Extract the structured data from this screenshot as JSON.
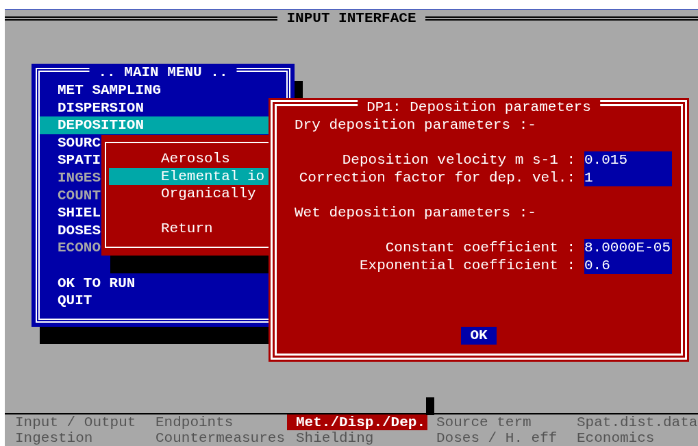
{
  "screen_title": "INPUT INTERFACE",
  "main_menu": {
    "title": ".. MAIN MENU ..",
    "items": [
      {
        "label": "MET SAMPLING",
        "selected": false,
        "disabled": false
      },
      {
        "label": "DISPERSION",
        "selected": false,
        "disabled": false
      },
      {
        "label": "DEPOSITION",
        "selected": true,
        "disabled": false
      },
      {
        "label": "SOURC",
        "selected": false,
        "disabled": false
      },
      {
        "label": "SPATI",
        "selected": false,
        "disabled": false
      },
      {
        "label": "INGES",
        "selected": false,
        "disabled": true
      },
      {
        "label": "COUNT",
        "selected": false,
        "disabled": true
      },
      {
        "label": "SHIEL",
        "selected": false,
        "disabled": false
      },
      {
        "label": "DOSES",
        "selected": false,
        "disabled": false
      },
      {
        "label": "ECONO",
        "selected": false,
        "disabled": true
      }
    ],
    "actions": [
      {
        "label": "OK TO RUN",
        "selected": false,
        "disabled": false
      },
      {
        "label": "QUIT",
        "selected": false,
        "disabled": false
      }
    ]
  },
  "submenu": {
    "items": [
      {
        "label": "Aerosols",
        "selected": false
      },
      {
        "label": "Elemental io",
        "selected": true
      },
      {
        "label": "Organically",
        "selected": false
      }
    ],
    "footer_items": [
      {
        "label": "Return",
        "selected": false
      }
    ]
  },
  "dialog": {
    "title": "DP1: Deposition parameters",
    "sections": [
      {
        "heading": "Dry deposition parameters :-",
        "fields": [
          {
            "label": "Deposition velocity m s-1 :",
            "value": "0.015"
          },
          {
            "label": "Correction factor for dep. vel.:",
            "value": "1"
          }
        ]
      },
      {
        "heading": "Wet deposition parameters :-",
        "fields": [
          {
            "label": "Constant coefficient :",
            "value": "8.0000E-05"
          },
          {
            "label": "Exponential coefficient :",
            "value": "0.6"
          }
        ]
      }
    ],
    "button": "OK"
  },
  "status_bar": {
    "items": [
      {
        "label": "Input / Output",
        "selected": false
      },
      {
        "label": "Endpoints",
        "selected": false
      },
      {
        "label": "Met./Disp./Dep.",
        "selected": true
      },
      {
        "label": "Source term",
        "selected": false
      },
      {
        "label": "Spat.dist.data",
        "selected": false
      },
      {
        "label": "Ingestion",
        "selected": false
      },
      {
        "label": "Countermeasures",
        "selected": false
      },
      {
        "label": "Shielding",
        "selected": false
      },
      {
        "label": "Doses / H. eff",
        "selected": false
      },
      {
        "label": "Economics",
        "selected": false
      }
    ]
  }
}
